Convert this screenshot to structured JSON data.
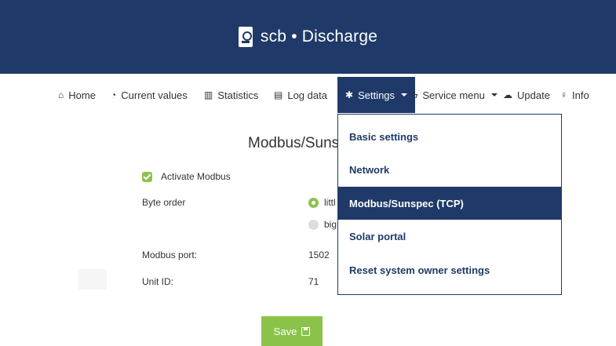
{
  "header": {
    "title": "scb • Discharge",
    "icon": "device-icon",
    "background": "#1f3a68"
  },
  "nav": {
    "items": [
      {
        "label": "Home",
        "icon": "home-icon"
      },
      {
        "label": "Current values",
        "icon": "dashboard-icon"
      },
      {
        "label": "Statistics",
        "icon": "bar-chart-icon"
      },
      {
        "label": "Log data",
        "icon": "document-icon"
      },
      {
        "label": "Settings",
        "icon": "gear-icon",
        "active": true
      },
      {
        "label": "Service menu",
        "icon": "bolt-icon"
      },
      {
        "label": "Update",
        "icon": "cloud-upload-icon"
      },
      {
        "label": "Info",
        "icon": "lightbulb-icon"
      }
    ]
  },
  "page": {
    "heading": "Modbus/Suns"
  },
  "form": {
    "activate_label": "Activate Modbus",
    "activate_checked": true,
    "byte_order_label": "Byte order",
    "byte_order_options": [
      {
        "label": "littl",
        "selected": true
      },
      {
        "label": "big",
        "selected": false
      }
    ],
    "port_label": "Modbus port:",
    "port_value": "1502",
    "unit_label": "Unit ID:",
    "unit_value": "71"
  },
  "save_button": {
    "label": "Save"
  },
  "dropdown": {
    "items": [
      {
        "label": "Basic settings"
      },
      {
        "label": "Network"
      },
      {
        "label": "Modbus/Sunspec (TCP)",
        "selected": true
      },
      {
        "label": "Solar portal"
      },
      {
        "label": "Reset system owner settings"
      }
    ]
  },
  "colors": {
    "accent": "#8bc34a",
    "primary": "#1f3a68"
  }
}
